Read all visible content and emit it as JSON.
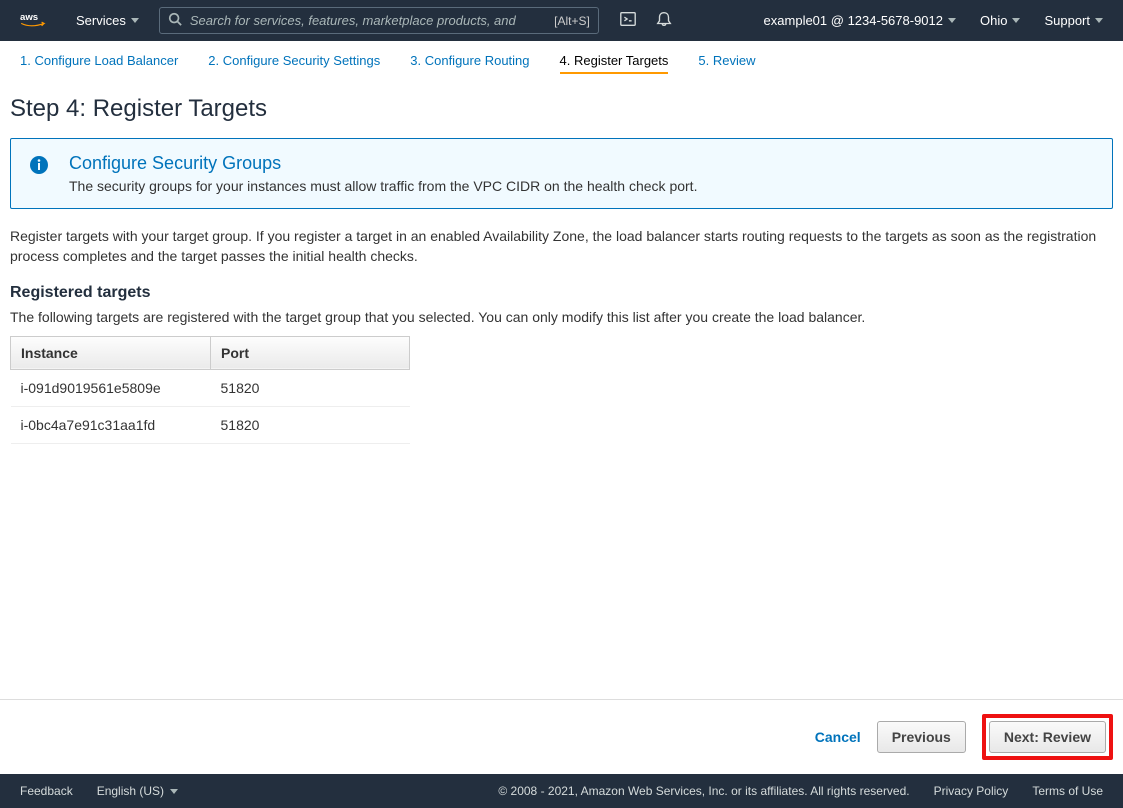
{
  "nav": {
    "services": "Services",
    "search_placeholder": "Search for services, features, marketplace products, and",
    "shortcut": "[Alt+S]",
    "account": "example01 @ 1234-5678-9012",
    "region": "Ohio",
    "support": "Support"
  },
  "wizard": {
    "tab1": "1. Configure Load Balancer",
    "tab2": "2. Configure Security Settings",
    "tab3": "3. Configure Routing",
    "tab4": "4. Register Targets",
    "tab5": "5. Review"
  },
  "page": {
    "title": "Step 4: Register Targets",
    "info_title": "Configure Security Groups",
    "info_desc": "The security groups for your instances must allow traffic from the VPC CIDR on the health check port.",
    "intro": "Register targets with your target group. If you register a target in an enabled Availability Zone, the load balancer starts routing requests to the targets as soon as the registration process completes and the target passes the initial health checks.",
    "reg_heading": "Registered targets",
    "reg_desc": "The following targets are registered with the target group that you selected. You can only modify this list after you create the load balancer.",
    "th_instance": "Instance",
    "th_port": "Port",
    "rows": [
      {
        "instance": "i-091d9019561e5809e",
        "port": "51820"
      },
      {
        "instance": "i-0bc4a7e91c31aa1fd",
        "port": "51820"
      }
    ]
  },
  "buttons": {
    "cancel": "Cancel",
    "previous": "Previous",
    "next": "Next: Review"
  },
  "footer": {
    "feedback": "Feedback",
    "language": "English (US)",
    "copyright": "© 2008 - 2021, Amazon Web Services, Inc. or its affiliates. All rights reserved.",
    "privacy": "Privacy Policy",
    "terms": "Terms of Use"
  }
}
